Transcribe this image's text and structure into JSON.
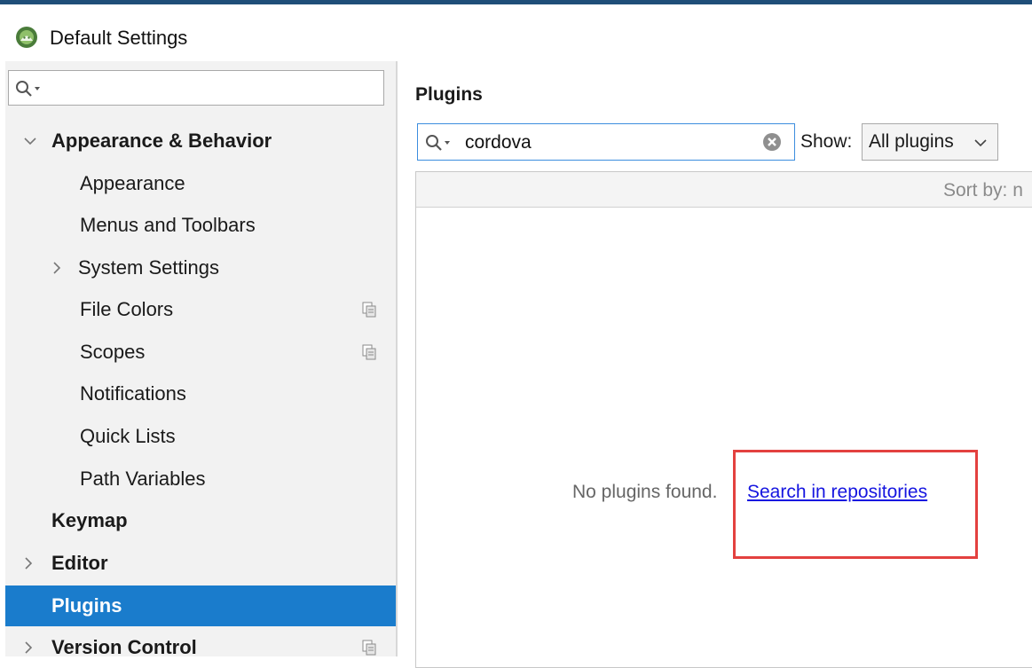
{
  "window": {
    "title": "Default Settings",
    "app_icon": "android-studio-icon"
  },
  "sidebar": {
    "search": {
      "placeholder": "",
      "icon": "search-icon"
    },
    "items": [
      {
        "label": "Appearance & Behavior",
        "bold": true,
        "expanded": true
      },
      {
        "label": "Appearance"
      },
      {
        "label": "Menus and Toolbars"
      },
      {
        "label": "System Settings",
        "collapsed": true
      },
      {
        "label": "File Colors",
        "copy_icon": true
      },
      {
        "label": "Scopes",
        "copy_icon": true
      },
      {
        "label": "Notifications"
      },
      {
        "label": "Quick Lists"
      },
      {
        "label": "Path Variables"
      },
      {
        "label": "Keymap",
        "bold": true
      },
      {
        "label": "Editor",
        "bold": true,
        "collapsed": true
      },
      {
        "label": "Plugins",
        "bold": true,
        "selected": true
      },
      {
        "label": "Version Control",
        "bold": true,
        "collapsed": true,
        "copy_icon": true
      }
    ]
  },
  "plugins": {
    "title": "Plugins",
    "search": {
      "value": "cordova"
    },
    "show_label": "Show:",
    "show_value": "All plugins",
    "sort_label": "Sort by: n",
    "empty_message": "No plugins found.",
    "repo_link": "Search in repositories"
  },
  "colors": {
    "selected": "#1a7ccc",
    "link": "#1515e0",
    "annotation": "#e3413f",
    "focus": "#3c8dde"
  }
}
